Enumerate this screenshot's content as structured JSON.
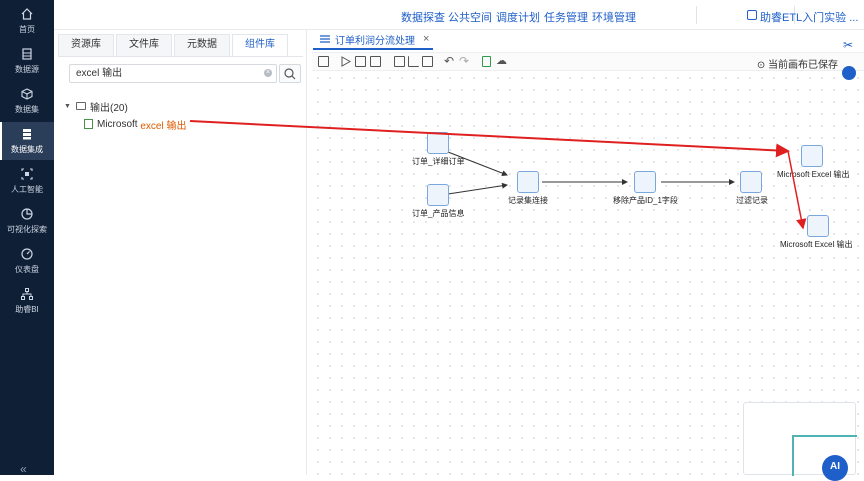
{
  "nav": {
    "items": [
      {
        "label": "首页",
        "icon": "home-icon"
      },
      {
        "label": "数据源",
        "icon": "database-icon"
      },
      {
        "label": "数据集",
        "icon": "cube-icon"
      },
      {
        "label": "数据集成",
        "icon": "stack-icon"
      },
      {
        "label": "人工智能",
        "icon": "ai-icon"
      },
      {
        "label": "可视化探索",
        "icon": "chart-icon"
      },
      {
        "label": "仪表盘",
        "icon": "gauge-icon"
      },
      {
        "label": "助睿BI",
        "icon": "org-icon"
      }
    ],
    "collapse": "«"
  },
  "top_menu": [
    "数据探查",
    "公共空间",
    "调度计划",
    "任务管理",
    "环境管理"
  ],
  "guide_label": "助睿ETL入门实验 ...",
  "panel": {
    "tabs": [
      "资源库",
      "文件库",
      "元数据",
      "组件库"
    ],
    "search_value": "excel 输出",
    "tree": {
      "folder": "输出(20)",
      "item_prefix": "Microsoft ",
      "item_highlight": "excel 输出"
    }
  },
  "editor": {
    "tab_title": "订单利润分流处理",
    "saved_status": "当前画布已保存"
  },
  "flow": {
    "nodes": [
      {
        "id": "order-detail",
        "label": "订单_详细订单"
      },
      {
        "id": "order-product",
        "label": "订单_产品信息"
      },
      {
        "id": "record-join",
        "label": "记录集连接"
      },
      {
        "id": "remove-field",
        "label": "移除产品ID_1字段"
      },
      {
        "id": "filter",
        "label": "过滤记录"
      },
      {
        "id": "excel-out-1",
        "label": "Microsoft Excel 输出"
      },
      {
        "id": "excel-out-2",
        "label": "Microsoft Excel 输出"
      }
    ]
  },
  "ai_label": "AI"
}
